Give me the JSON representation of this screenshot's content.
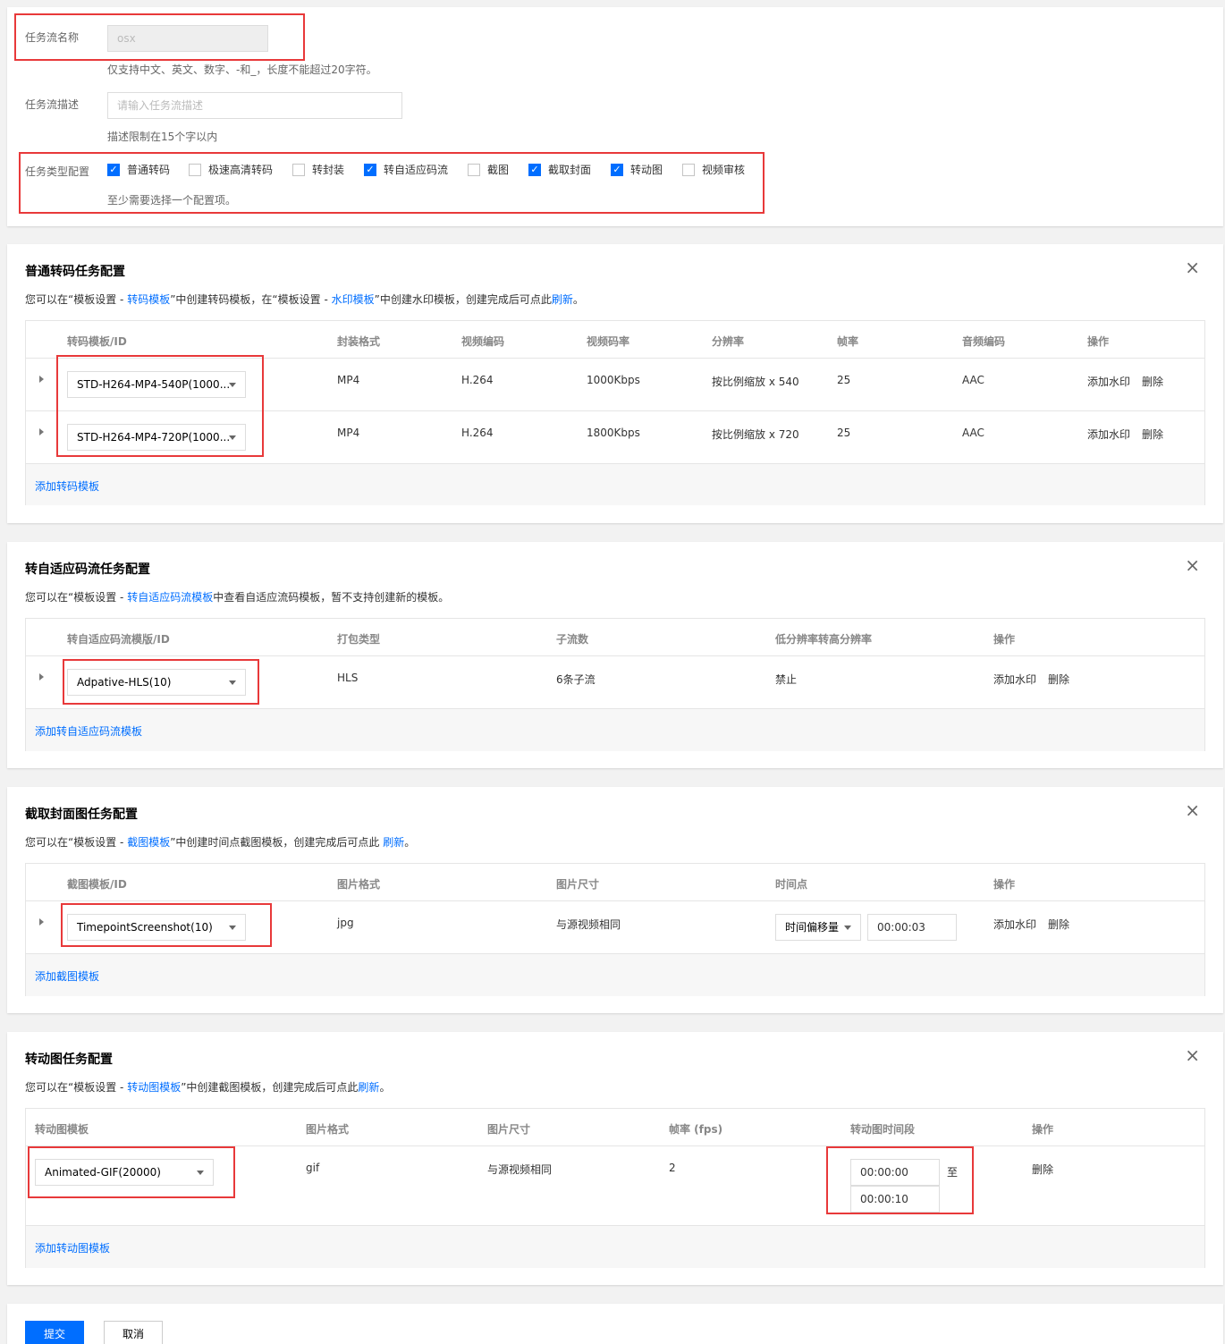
{
  "basic": {
    "name_label": "任务流名称",
    "name_value": "osx",
    "name_hint": "仅支持中文、英文、数字、-和_，长度不能超过20字符。",
    "desc_label": "任务流描述",
    "desc_placeholder": "请输入任务流描述",
    "desc_hint": "描述限制在15个字以内",
    "type_label": "任务类型配置",
    "type_hint": "至少需要选择一个配置项。",
    "types": [
      {
        "label": "普通转码",
        "checked": true
      },
      {
        "label": "极速高清转码",
        "checked": false
      },
      {
        "label": "转封装",
        "checked": false
      },
      {
        "label": "转自适应码流",
        "checked": true
      },
      {
        "label": "截图",
        "checked": false
      },
      {
        "label": "截取封面",
        "checked": true
      },
      {
        "label": "转动图",
        "checked": true
      },
      {
        "label": "视频审核",
        "checked": false
      }
    ]
  },
  "transcode": {
    "title": "普通转码任务配置",
    "desc_pre": "您可以在“模板设置 - ",
    "desc_link1": "转码模板",
    "desc_mid1": "”中创建转码模板，在“模板设置 - ",
    "desc_link2": "水印模板",
    "desc_mid2": "”中创建水印模板，创建完成后可点此",
    "desc_link3": "刷新",
    "desc_end": "。",
    "headers": [
      "转码模板/ID",
      "封装格式",
      "视频编码",
      "视频码率",
      "分辨率",
      "帧率",
      "音频编码",
      "操作"
    ],
    "rows": [
      {
        "template": "STD-H264-MP4-540P(1000...",
        "format": "MP4",
        "vcodec": "H.264",
        "bitrate": "1000Kbps",
        "resolution": "按比例缩放 x 540",
        "fps": "25",
        "acodec": "AAC"
      },
      {
        "template": "STD-H264-MP4-720P(1000...",
        "format": "MP4",
        "vcodec": "H.264",
        "bitrate": "1800Kbps",
        "resolution": "按比例缩放 x 720",
        "fps": "25",
        "acodec": "AAC"
      }
    ],
    "action_watermark": "添加水印",
    "action_delete": "删除",
    "add_link": "添加转码模板"
  },
  "adaptive": {
    "title": "转自适应码流任务配置",
    "desc_pre": "您可以在“模板设置 - ",
    "desc_link1": "转自适应码流模板",
    "desc_end": "中查看自适应流码模板，暂不支持创建新的模板。",
    "headers": [
      "转自适应码流模版/ID",
      "打包类型",
      "子流数",
      "低分辨率转高分辨率",
      "操作"
    ],
    "row": {
      "template": "Adpative-HLS(10)",
      "package": "HLS",
      "streams": "6条子流",
      "upscale": "禁止"
    },
    "action_watermark": "添加水印",
    "action_delete": "删除",
    "add_link": "添加转自适应码流模板"
  },
  "cover": {
    "title": "截取封面图任务配置",
    "desc_pre": "您可以在“模板设置 - ",
    "desc_link1": "截图模板",
    "desc_mid1": "”中创建时间点截图模板，创建完成后可点此 ",
    "desc_link2": "刷新",
    "desc_end": "。",
    "headers": [
      "截图模板/ID",
      "图片格式",
      "图片尺寸",
      "时间点",
      "操作"
    ],
    "row": {
      "template": "TimepointScreenshot(10)",
      "format": "jpg",
      "size": "与源视频相同",
      "time_mode": "时间偏移量",
      "time_value": "00:00:03"
    },
    "action_watermark": "添加水印",
    "action_delete": "删除",
    "add_link": "添加截图模板"
  },
  "gif": {
    "title": "转动图任务配置",
    "desc_pre": "您可以在“模板设置 - ",
    "desc_link1": "转动图模板",
    "desc_mid1": "”中创建截图模板，创建完成后可点此",
    "desc_link2": "刷新",
    "desc_end": "。",
    "headers": [
      "转动图模板",
      "图片格式",
      "图片尺寸",
      "帧率 (fps)",
      "转动图时间段",
      "操作"
    ],
    "row": {
      "template": "Animated-GIF(20000)",
      "format": "gif",
      "size": "与源视频相同",
      "fps": "2",
      "start": "00:00:00",
      "to": "至",
      "end": "00:00:10"
    },
    "action_delete": "删除",
    "add_link": "添加转动图模板"
  },
  "footer": {
    "submit": "提交",
    "cancel": "取消"
  },
  "icons": {
    "close": "×",
    "check": "✓"
  },
  "colors": {
    "primary": "#006eff",
    "highlight": "#e8393a"
  }
}
